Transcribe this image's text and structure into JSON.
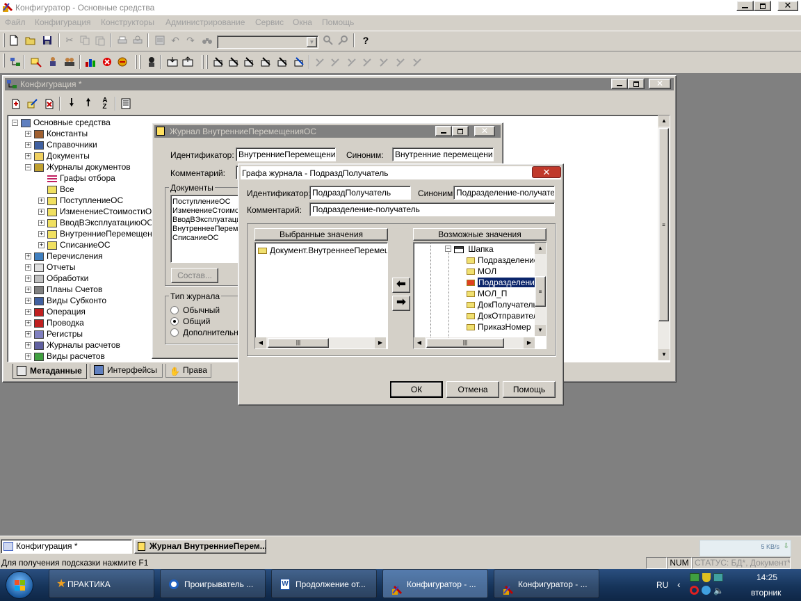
{
  "app": {
    "title": "Конфигуратор - Основные средства",
    "menu": [
      "Файл",
      "Конфигурация",
      "Конструкторы",
      "Администрирование",
      "Сервис",
      "Окна",
      "Помощь"
    ]
  },
  "config_window": {
    "title": "Конфигурация *",
    "tree": [
      {
        "label": "Основные средства",
        "level": 0,
        "toggle": "−",
        "icon": "config-icon"
      },
      {
        "label": "Константы",
        "level": 1,
        "toggle": "+",
        "icon": "constants-icon"
      },
      {
        "label": "Справочники",
        "level": 1,
        "toggle": "+",
        "icon": "catalogs-icon"
      },
      {
        "label": "Документы",
        "level": 1,
        "toggle": "+",
        "icon": "folder-icon"
      },
      {
        "label": "Журналы документов",
        "level": 1,
        "toggle": "−",
        "icon": "journals-icon"
      },
      {
        "label": "Графы отбора",
        "level": 2,
        "toggle": "",
        "icon": "filter-columns-icon"
      },
      {
        "label": "Все",
        "level": 2,
        "toggle": "",
        "icon": "journal-icon"
      },
      {
        "label": "ПоступлениеОС",
        "level": 2,
        "toggle": "+",
        "icon": "journal-icon"
      },
      {
        "label": "ИзменениеСтоимостиОС",
        "level": 2,
        "toggle": "+",
        "icon": "journal-icon"
      },
      {
        "label": "ВводВЭксплуатациюОС",
        "level": 2,
        "toggle": "+",
        "icon": "journal-icon"
      },
      {
        "label": "ВнутренниеПеремещенияОС",
        "level": 2,
        "toggle": "+",
        "icon": "journal-icon"
      },
      {
        "label": "СписаниеОС",
        "level": 2,
        "toggle": "+",
        "icon": "journal-icon"
      },
      {
        "label": "Перечисления",
        "level": 1,
        "toggle": "+",
        "icon": "enums-icon"
      },
      {
        "label": "Отчеты",
        "level": 1,
        "toggle": "+",
        "icon": "reports-icon"
      },
      {
        "label": "Обработки",
        "level": 1,
        "toggle": "+",
        "icon": "processing-icon"
      },
      {
        "label": "Планы Счетов",
        "level": 1,
        "toggle": "+",
        "icon": "accounts-icon"
      },
      {
        "label": "Виды Субконто",
        "level": 1,
        "toggle": "+",
        "icon": "subconto-icon"
      },
      {
        "label": "Операция",
        "level": 1,
        "toggle": "+",
        "icon": "operation-icon"
      },
      {
        "label": "Проводка",
        "level": 1,
        "toggle": "+",
        "icon": "posting-icon"
      },
      {
        "label": "Регистры",
        "level": 1,
        "toggle": "+",
        "icon": "registers-icon"
      },
      {
        "label": "Журналы расчетов",
        "level": 1,
        "toggle": "+",
        "icon": "calc-journals-icon"
      },
      {
        "label": "Виды расчетов",
        "level": 1,
        "toggle": "+",
        "icon": "calc-types-icon"
      }
    ],
    "tabs": [
      "Метаданные",
      "Интерфейсы",
      "Права"
    ]
  },
  "journal_window": {
    "title": "Журнал ВнутренниеПеремещенияОС",
    "id_label": "Идентификатор:",
    "id_value": "ВнутренниеПеремещенияОС",
    "synonym_label": "Синоним:",
    "synonym_value": "Внутренние перемещения",
    "comment_label": "Комментарий:",
    "docs_group": "Документы",
    "docs": [
      "ПоступлениеОС",
      "ИзменениеСтоимостиОС",
      "ВводВЭксплуатациюОС",
      "ВнутреннееПеремещениеОС",
      "СписаниеОС"
    ],
    "compose_button": "Состав...",
    "type_group": "Тип журнала",
    "type_options": [
      "Обычный",
      "Общий",
      "Дополнительный"
    ],
    "selected_type": "Общий"
  },
  "dialog": {
    "title": "Графа журнала -  ПодраздПолучатель",
    "id_label": "Идентификатор:",
    "id_value": "ПодраздПолучатель",
    "synonym_label": "Синоним:",
    "synonym_value": "Подразделение-получатель",
    "comment_label": "Комментарий:",
    "comment_value": "Подразделение-получатель",
    "selected_header": "Выбранные значения",
    "selected_items": [
      "Документ.ВнутреннееПеремещение.ПодразделениеПолучатель"
    ],
    "possible_header": "Возможные значения",
    "possible_parent": "Шапка",
    "possible_items": [
      "ПодразделениеОтправитель",
      "МОЛ",
      "ПодразделениеПолучатель",
      "МОЛ_П",
      "ДокПолучатель",
      "ДокОтправитель",
      "ПриказНомер"
    ],
    "possible_selected_index": 2,
    "ok": "ОК",
    "cancel": "Отмена",
    "help": "Помощь"
  },
  "mdi_tabs": [
    "Конфигурация *",
    "Журнал ВнутренниеПерем..."
  ],
  "status": {
    "hint": "Для получения подсказки нажмите F1",
    "num": "NUM",
    "db_status": "СТАТУС: БД*, Документ*",
    "net_speed": "5 KB/s"
  },
  "taskbar": {
    "items": [
      "ПРАКТИКА",
      "Проигрыватель ...",
      "Продолжение от...",
      "Конфигуратор - ...",
      "Конфигуратор - ..."
    ],
    "lang": "RU",
    "time": "14:25",
    "day": "вторник"
  },
  "colors": {
    "face": "#d4d0c8",
    "selection": "#0a246a",
    "desktop": "#808080",
    "taskbar": "#1c3d6e"
  }
}
